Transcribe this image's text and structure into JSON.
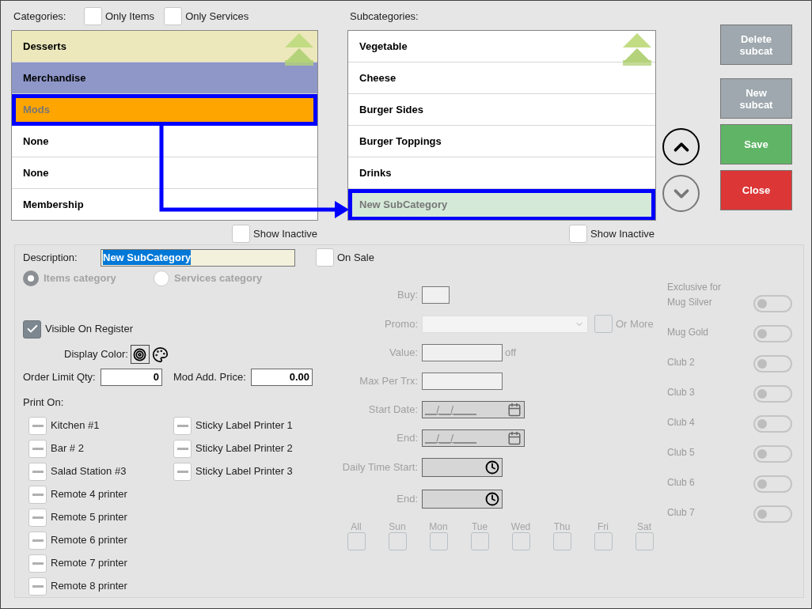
{
  "categories": {
    "label": "Categories:",
    "filters": [
      {
        "label": "Only Items",
        "checked": false
      },
      {
        "label": "Only Services",
        "checked": false
      }
    ],
    "items": [
      {
        "name": "Desserts",
        "color": "#ece8bb",
        "selected": false
      },
      {
        "name": "Merchandise",
        "color": "#8e97c8",
        "selected": false
      },
      {
        "name": "Mods",
        "color": "#ffa500",
        "selected": true
      },
      {
        "name": "None",
        "color": "#ffffff",
        "selected": false
      },
      {
        "name": "None",
        "color": "#ffffff",
        "selected": false
      },
      {
        "name": "Membership",
        "color": "#ffffff",
        "selected": false
      }
    ],
    "show_inactive": {
      "label": "Show Inactive",
      "checked": false
    }
  },
  "subcategories": {
    "label": "Subcategories:",
    "items": [
      {
        "name": "Vegetable",
        "color": "#ffffff",
        "selected": false
      },
      {
        "name": "Cheese",
        "color": "#ffffff",
        "selected": false
      },
      {
        "name": "Burger Sides",
        "color": "#ffffff",
        "selected": false
      },
      {
        "name": "Burger Toppings",
        "color": "#ffffff",
        "selected": false
      },
      {
        "name": "Drinks",
        "color": "#ffffff",
        "selected": false
      },
      {
        "name": "New SubCategory",
        "color": "#d5e9d8",
        "selected": true
      }
    ],
    "show_inactive": {
      "label": "Show Inactive",
      "checked": false
    }
  },
  "reorder": [
    {
      "kind": "up",
      "disabled": false
    },
    {
      "kind": "down",
      "disabled": true
    }
  ],
  "actions": [
    {
      "label": "Delete subcat",
      "color": "#9ea8ae"
    },
    {
      "label": "New subcat",
      "color": "#9ea8ae"
    },
    {
      "label": "Save",
      "color": "#5fb565"
    },
    {
      "label": "Close",
      "color": "#dc3636"
    }
  ],
  "details": {
    "description": {
      "label": "Description:",
      "value": "New SubCategory"
    },
    "on_sale": {
      "label": "On Sale",
      "checked": false
    },
    "category_type": {
      "disabled": true,
      "options": [
        {
          "label": "Items category",
          "selected": true
        },
        {
          "label": "Services category",
          "selected": false
        }
      ]
    },
    "visible_on_register": {
      "label": "Visible On Register",
      "checked": true
    },
    "display_color": {
      "label": "Display Color:"
    },
    "order_limit_qty": {
      "label": "Order Limit Qty:",
      "value": "0"
    },
    "mod_add_price": {
      "label": "Mod Add. Price:",
      "value": "0.00"
    },
    "print_on": {
      "label": "Print On:",
      "columns": [
        {
          "printers": [
            {
              "name": "Kitchen #1",
              "indeterminate": true
            },
            {
              "name": "Bar # 2",
              "indeterminate": true
            },
            {
              "name": "Salad Station #3",
              "indeterminate": true
            },
            {
              "name": "Remote 4 printer",
              "indeterminate": true
            },
            {
              "name": "Remote 5 printer",
              "indeterminate": true
            },
            {
              "name": "Remote 6 printer",
              "indeterminate": true
            },
            {
              "name": "Remote 7 printer",
              "indeterminate": true
            },
            {
              "name": "Remote 8 printer",
              "indeterminate": true
            }
          ]
        },
        {
          "printers": [
            {
              "name": "Sticky Label Printer 1",
              "indeterminate": true
            },
            {
              "name": "Sticky Label Printer 2",
              "indeterminate": true
            },
            {
              "name": "Sticky Label Printer 3",
              "indeterminate": true
            }
          ]
        }
      ]
    }
  },
  "promo": {
    "disabled": true,
    "buy": {
      "label": "Buy:"
    },
    "promo": {
      "label": "Promo:",
      "or_more": {
        "label": "Or More",
        "checked": false
      }
    },
    "value": {
      "label": "Value:",
      "suffix": "off"
    },
    "max_per_trx": {
      "label": "Max Per Trx:"
    },
    "start_date": {
      "label": "Start Date:",
      "mask": "__/__/____"
    },
    "end_date": {
      "label": "End:",
      "mask": "__/__/____"
    },
    "daily_time_start": {
      "label": "Daily Time Start:"
    },
    "daily_time_end": {
      "label": "End:"
    },
    "days": [
      {
        "label": "All",
        "checked": false
      },
      {
        "label": "Sun",
        "checked": false
      },
      {
        "label": "Mon",
        "checked": false
      },
      {
        "label": "Tue",
        "checked": false
      },
      {
        "label": "Wed",
        "checked": false
      },
      {
        "label": "Thu",
        "checked": false
      },
      {
        "label": "Fri",
        "checked": false
      },
      {
        "label": "Sat",
        "checked": false
      }
    ]
  },
  "exclusive": {
    "label": "Exclusive for",
    "disabled": true,
    "clubs": [
      {
        "name": "Mug Silver",
        "on": false
      },
      {
        "name": "Mug Gold",
        "on": false
      },
      {
        "name": "Club 2",
        "on": false
      },
      {
        "name": "Club 3",
        "on": false
      },
      {
        "name": "Club 4",
        "on": false
      },
      {
        "name": "Club 5",
        "on": false
      },
      {
        "name": "Club 6",
        "on": false
      },
      {
        "name": "Club 7",
        "on": false
      }
    ]
  }
}
